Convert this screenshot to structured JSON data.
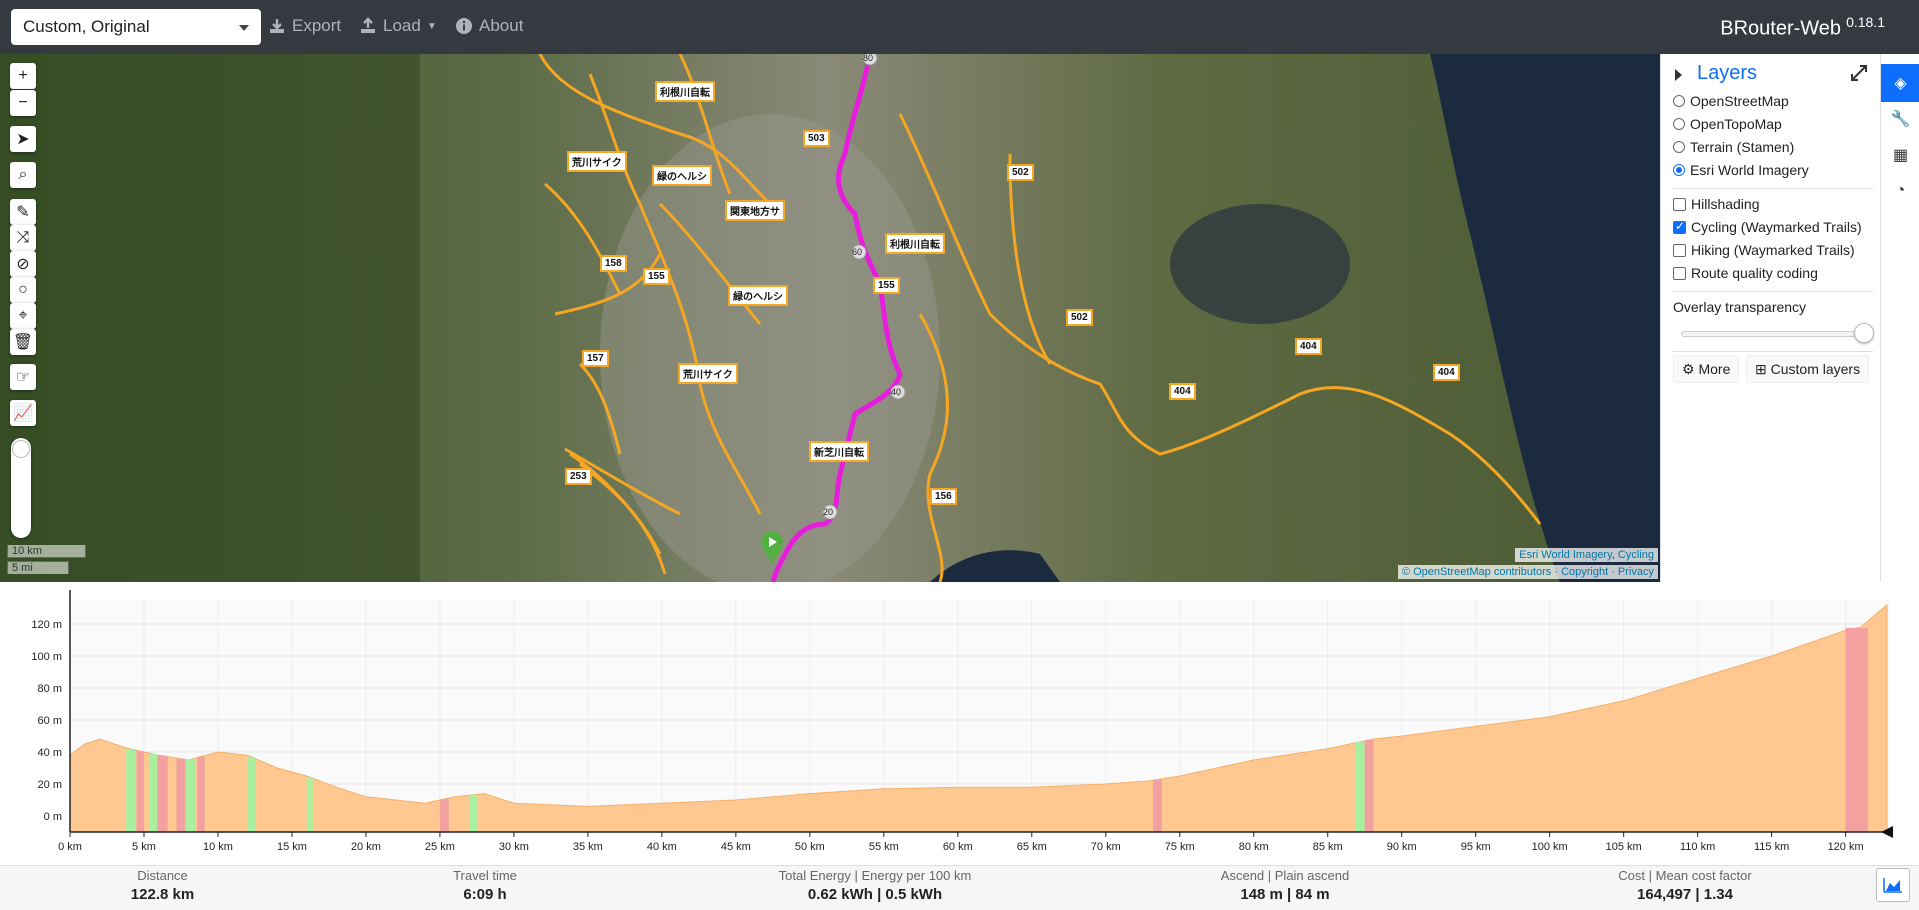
{
  "topbar": {
    "profile_value": "Custom, Original",
    "export_label": "Export",
    "load_label": "Load",
    "about_label": "About",
    "brand": "BRouter-Web",
    "version": "0.18.1"
  },
  "map": {
    "road_labels": [
      "利根川自転",
      "荒川サイク",
      "緑のヘルシ",
      "関東地方サ",
      "利根川自転",
      "緑のヘルシ",
      "荒川サイク",
      "新芝川自転",
      "503",
      "502",
      "158",
      "155",
      "157",
      "502",
      "404",
      "404",
      "404",
      "253",
      "156",
      "155"
    ],
    "route_markers": [
      "80",
      "60",
      "40",
      "20"
    ],
    "scale_km": "10 km",
    "scale_mi": "5 mi",
    "attribution_top": "Esri World Imagery",
    "attribution_top_link2": "Cycling",
    "attribution_bottom": "© OpenStreetMap contributors · Copyright · Privacy"
  },
  "layers": {
    "title": "Layers",
    "base": [
      {
        "label": "OpenStreetMap",
        "checked": false
      },
      {
        "label": "OpenTopoMap",
        "checked": false
      },
      {
        "label": "Terrain (Stamen)",
        "checked": false
      },
      {
        "label": "Esri World Imagery",
        "checked": true
      }
    ],
    "overlays": [
      {
        "label": "Hillshading",
        "checked": false
      },
      {
        "label": "Cycling (Waymarked Trails)",
        "checked": true
      },
      {
        "label": "Hiking (Waymarked Trails)",
        "checked": false
      },
      {
        "label": "Route quality coding",
        "checked": false
      }
    ],
    "transparency_label": "Overlay transparency",
    "transparency_value": 0.95,
    "more_label": "More",
    "custom_label": "Custom layers"
  },
  "tabs": [
    "layers-icon",
    "wrench-icon",
    "table-icon",
    "pie-chart-icon"
  ],
  "chart_data": {
    "type": "area",
    "title": "",
    "xlabel": "",
    "ylabel": "",
    "xlim": [
      0,
      123
    ],
    "ylim": [
      -10,
      135
    ],
    "y_ticks": [
      "0 m",
      "20 m",
      "40 m",
      "60 m",
      "80 m",
      "100 m",
      "120 m"
    ],
    "x_ticks": [
      "0 km",
      "5 km",
      "10 km",
      "15 km",
      "20 km",
      "25 km",
      "30 km",
      "35 km",
      "40 km",
      "45 km",
      "50 km",
      "55 km",
      "60 km",
      "65 km",
      "70 km",
      "75 km",
      "80 km",
      "85 km",
      "90 km",
      "95 km",
      "100 km",
      "105 km",
      "110 km",
      "115 km",
      "120 km"
    ],
    "x": [
      0,
      1,
      2,
      4,
      6,
      8,
      10,
      12,
      14,
      16,
      18,
      20,
      22,
      24,
      26,
      28,
      30,
      35,
      40,
      45,
      50,
      55,
      60,
      65,
      70,
      73,
      75,
      80,
      85,
      88,
      90,
      95,
      100,
      105,
      110,
      115,
      120,
      121,
      122.8
    ],
    "y": [
      38,
      45,
      48,
      42,
      38,
      35,
      40,
      38,
      30,
      25,
      18,
      12,
      10,
      8,
      12,
      14,
      8,
      6,
      8,
      10,
      14,
      17,
      18,
      18,
      20,
      22,
      25,
      35,
      42,
      48,
      50,
      56,
      62,
      72,
      86,
      100,
      116,
      118,
      132
    ],
    "color_fill": "#ffc890",
    "color_steep": "#f2a0a0",
    "color_descent": "#a8f0a0"
  },
  "stats": [
    {
      "label": "Distance",
      "value": "122.8 km"
    },
    {
      "label": "Travel time",
      "value": "6:09 h"
    },
    {
      "label": "Total Energy | Energy per 100 km",
      "value": "0.62 kWh | 0.5 kWh"
    },
    {
      "label": "Ascend | Plain ascend",
      "value": "148 m | 84 m"
    },
    {
      "label": "Cost | Mean cost factor",
      "value": "164,497 | 1.34"
    }
  ]
}
